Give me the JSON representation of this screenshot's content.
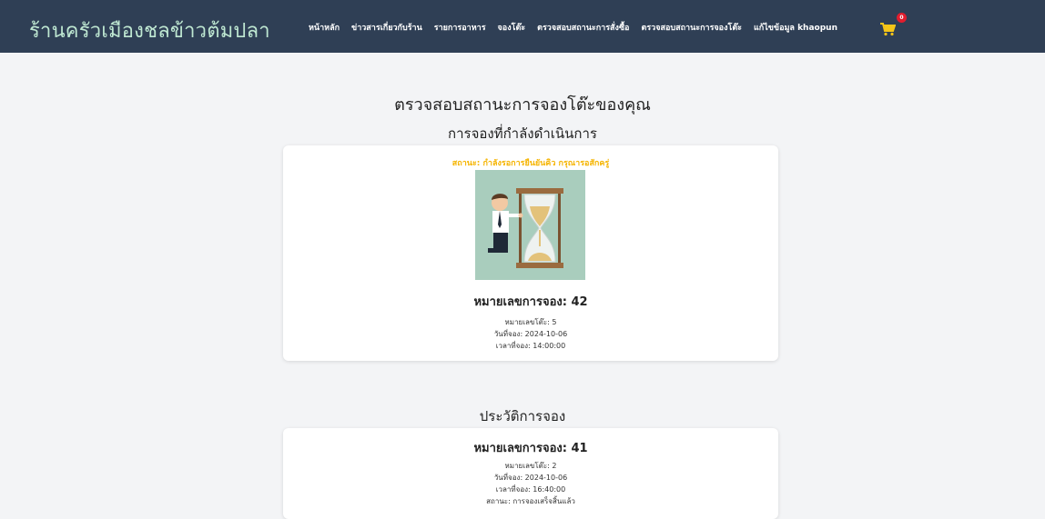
{
  "nav": {
    "brand": "ร้านครัวเมืองชลข้าวต้มปลา",
    "links": [
      "หน้าหลัก",
      "ข่าวสารเกี่ยวกับร้าน",
      "รายการอาหาร",
      "จองโต๊ะ",
      "ตรวจสอบสถานะการสั่งซื้อ",
      "ตรวจสอบสถานะการจองโต๊ะ",
      "แก้ไขข้อมูล khaopun"
    ],
    "cart_count": "0",
    "cart_icon": "cart-icon"
  },
  "page": {
    "title": "ตรวจสอบสถานะการจองโต๊ะของคุณ"
  },
  "current": {
    "heading": "การจองที่กำลังดำเนินการ",
    "status": "สถานะ: กำลังรอการยืนยันคิว กรุณารอสักครู่",
    "booking_label": "หมายเลขการจอง: 42",
    "table": "หมายเลขโต๊ะ: 5",
    "date": "วันที่จอง: 2024-10-06",
    "time": "เวลาที่จอง: 14:00:00"
  },
  "history": {
    "heading": "ประวัติการจอง",
    "items": [
      {
        "booking_label": "หมายเลขการจอง: 41",
        "table": "หมายเลขโต๊ะ: 2",
        "date": "วันที่จอง: 2024-10-06",
        "time": "เวลาที่จอง: 16:40:00",
        "status": "สถานะ: การจองเสร็จสิ้นแล้ว"
      }
    ]
  },
  "colors": {
    "navbar": "#2f3f55",
    "brand": "#bfe8d2",
    "status_pending": "#f5b400",
    "badge": "#e11d2e"
  }
}
